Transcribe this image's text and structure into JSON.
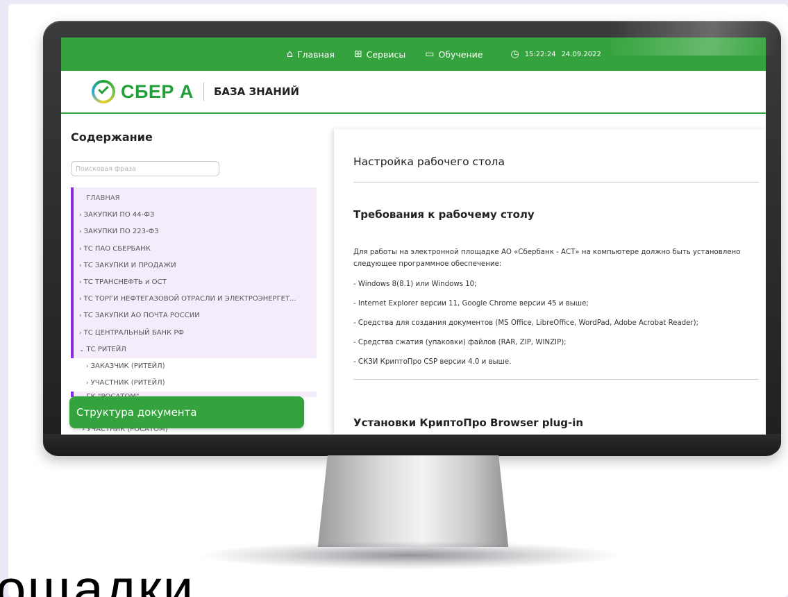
{
  "topbar": {
    "home_label": "Главная",
    "services_label": "Сервисы",
    "learning_label": "Обучение",
    "time": "15:22:24",
    "date": "24.09.2022"
  },
  "logo": {
    "brand": "СБЕР А",
    "section_title": "БАЗА ЗНАНИЙ"
  },
  "sidebar": {
    "title": "Содержание",
    "search_placeholder": "Поисковая фраза",
    "items": [
      {
        "label": "ГЛАВНАЯ"
      },
      {
        "label": "ЗАКУПКИ ПО 44-ФЗ"
      },
      {
        "label": "ЗАКУПКИ ПО 223-ФЗ"
      },
      {
        "label": "ТС ПАО СБЕРБАНК"
      },
      {
        "label": "ТС ЗАКУПКИ И ПРОДАЖИ"
      },
      {
        "label": "ТС ТРАНСНЕФТЬ и ОСТ"
      },
      {
        "label": "ТС ТОРГИ НЕФТЕГАЗОВОЙ ОТРАСЛИ И ЭЛЕКТРОЭНЕРГЕТ..."
      },
      {
        "label": "ТС ЗАКУПКИ АО ПОЧТА РОССИИ"
      },
      {
        "label": "ТС ЦЕНТРАЛЬНЫЙ БАНК РФ"
      },
      {
        "label": "ТС РИТЕЙЛ"
      },
      {
        "label": "ЗАКАЗЧИК (РИТЕЙЛ)"
      },
      {
        "label": "УЧАСТНИК (РИТЕЙЛ)"
      },
      {
        "label": "ГК \"РОСАТОМ\""
      },
      {
        "label": "УЧАСТНИК (РОСАТОМ)"
      }
    ],
    "doc_structure_label": "Структура документа"
  },
  "content": {
    "title": "Настройка рабочего стола",
    "section1_title": "Требования к рабочему столу",
    "intro": "Для работы на электронной площадке АО «Сбербанк - АСТ» на компьютере должно быть установлено следующее программное обеспечение:",
    "requirements": [
      "- Windows 8(8.1) или Windows 10;",
      "- Internet Explorer версии 11, Google Chrome версии 45 и выше;",
      "- Средства для создания документов (MS Office, LibreOffice, WordPad, Adobe Acrobat Reader);",
      "- Средства сжатия (упаковки) файлов (RAR, ZIP, WINZIP);",
      "- СКЗИ КриптоПро CSP версии 4.0 и выше."
    ],
    "section2_title": "Установки КриптоПро Browser plug-in"
  },
  "overlay_text": "ощадки",
  "colors": {
    "accent_green": "#35a33d",
    "toc_purple": "#8a2be2",
    "page_background": "#ebe9f7"
  }
}
